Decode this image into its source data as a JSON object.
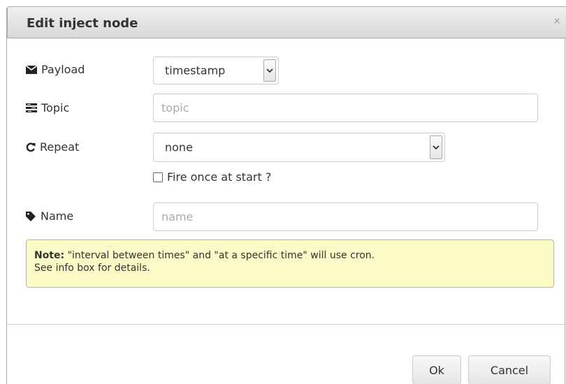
{
  "dialog": {
    "title": "Edit inject node",
    "close_glyph": "×"
  },
  "fields": {
    "payload": {
      "label": "Payload",
      "value": "timestamp",
      "icon": "envelope-icon"
    },
    "topic": {
      "label": "Topic",
      "placeholder": "topic",
      "value": "",
      "icon": "tasks-icon"
    },
    "repeat": {
      "label": "Repeat",
      "value": "none",
      "icon": "repeat-icon"
    },
    "fire_once": {
      "label": "Fire once at start ?",
      "checked": false
    },
    "name": {
      "label": "Name",
      "placeholder": "name",
      "value": "",
      "icon": "tag-icon"
    }
  },
  "note": {
    "prefix": "Note:",
    "line1": " \"interval between times\" and \"at a specific time\" will use cron.",
    "line2": "See info box for details."
  },
  "buttons": {
    "ok": "Ok",
    "cancel": "Cancel"
  }
}
